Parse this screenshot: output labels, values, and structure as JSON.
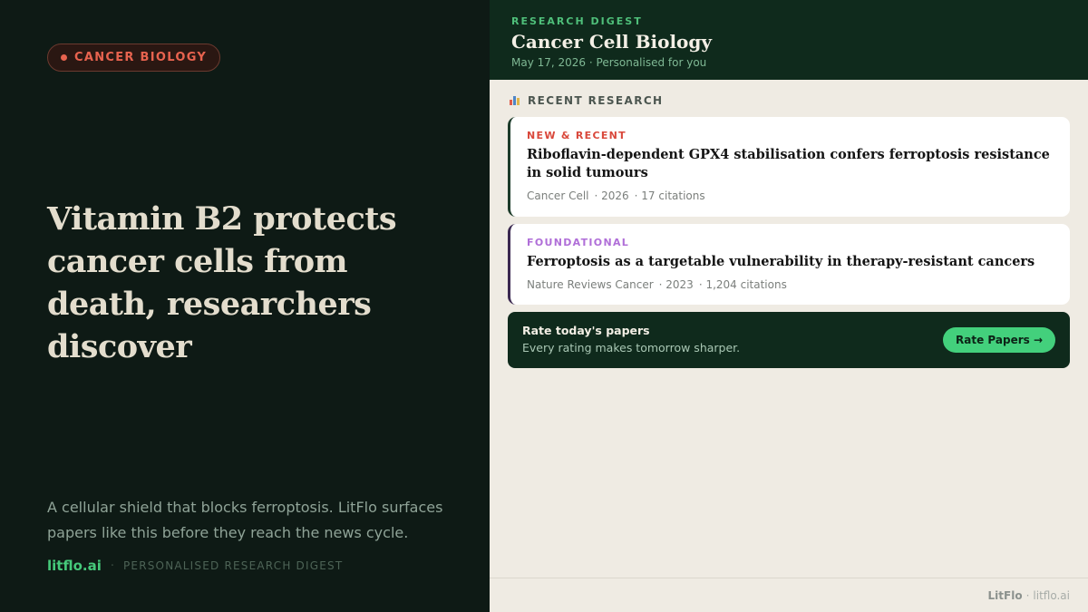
{
  "left": {
    "category": "CANCER BIOLOGY",
    "headline": "Vitamin B2 protects cancer cells from death, researchers discover",
    "blurb": "A cellular shield that blocks ferroptosis. LitFlo surfaces papers like this before they reach the news cycle.",
    "brand": "litflo.ai",
    "separator": "·",
    "tagline": "PERSONALISED RESEARCH DIGEST"
  },
  "digest": {
    "eyebrow": "RESEARCH DIGEST",
    "title": "Cancer Cell Biology",
    "date_line": "May 17, 2026 · Personalised for you",
    "section_label": "RECENT RESEARCH",
    "section_icon": "bar-chart-icon"
  },
  "papers": [
    {
      "badge": "NEW & RECENT",
      "badge_color": "#d9483b",
      "title": "Riboflavin-dependent GPX4 stabilisation confers ferroptosis resistance in solid tumours",
      "journal": "Cancer Cell",
      "year": "· 2026",
      "citations": "· 17 citations"
    },
    {
      "badge": "FOUNDATIONAL",
      "badge_color": "#b06fd8",
      "title": "Ferroptosis as a targetable vulnerability in therapy-resistant cancers",
      "journal": "Nature Reviews Cancer",
      "year": "· 2023",
      "citations": "· 1,204 citations"
    }
  ],
  "cta": {
    "title": "Rate today's papers",
    "subtitle": "Every rating makes tomorrow sharper.",
    "button_label": "Rate Papers →"
  },
  "footer": {
    "brand": "LitFlo",
    "separator": "·",
    "url": "litflo.ai"
  },
  "colors": {
    "left_bg": "#0e1a15",
    "header_bg": "#0f2a1c",
    "accent_green": "#43d07c",
    "category_red": "#e8634f",
    "panel_bg": "#efebe3"
  }
}
